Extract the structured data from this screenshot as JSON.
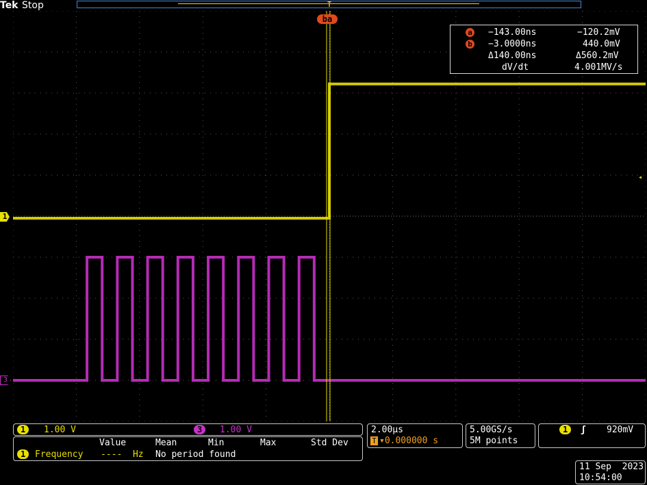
{
  "header": {
    "brand": "Tek",
    "status": "Stop"
  },
  "markers": {
    "trigger_position_label": "T",
    "cursor_pair_label": "ba",
    "channel1_label": "1",
    "channel3_label": "3"
  },
  "cursors": {
    "a_badge": "a",
    "b_badge": "b",
    "a_time": "−143.00ns",
    "a_value": "−120.2mV",
    "b_time": "−3.0000ns",
    "b_value": "440.0mV",
    "delta_time": "Δ140.00ns",
    "delta_value": "Δ560.2mV",
    "slope_label": "dV/dt",
    "slope_value": "4.001MV/s"
  },
  "channels": {
    "ch1_badge": "1",
    "ch1_scale": "1.00 V",
    "ch3_badge": "3",
    "ch3_scale": "1.00 V"
  },
  "measurements": {
    "headers": [
      "Value",
      "Mean",
      "Min",
      "Max",
      "Std Dev"
    ],
    "row_badge": "1",
    "row_name": "Frequency",
    "row_value": "----  Hz",
    "row_status": "No period found"
  },
  "horizontal": {
    "time_per_div": "2.00µs",
    "trigger_icon": "T",
    "delay": "▾0.000000 s"
  },
  "acquisition": {
    "sample_rate": "5.00GS/s",
    "record_length": "5M points"
  },
  "trigger": {
    "source_badge": "1",
    "slope_symbol": "ʃ",
    "level": "920mV"
  },
  "datetime": {
    "date": "11 Sep  2023",
    "time": "10:54:00"
  },
  "colors": {
    "ch1": "#e8e000",
    "ch3": "#c830c8",
    "grid": "#5a5a5a",
    "cursor_badge": "#e04a1a",
    "background": "#000000"
  },
  "waveforms": {
    "ch1_low_fraction": 0.505,
    "ch1_high_fraction": 0.178,
    "ch1_edge_fraction_x": 0.5,
    "ch3_high_fraction": 0.6,
    "ch3_low_fraction": 0.9,
    "ch3_pulses_start_fraction": 0.117,
    "ch3_pulse_count": 8
  }
}
